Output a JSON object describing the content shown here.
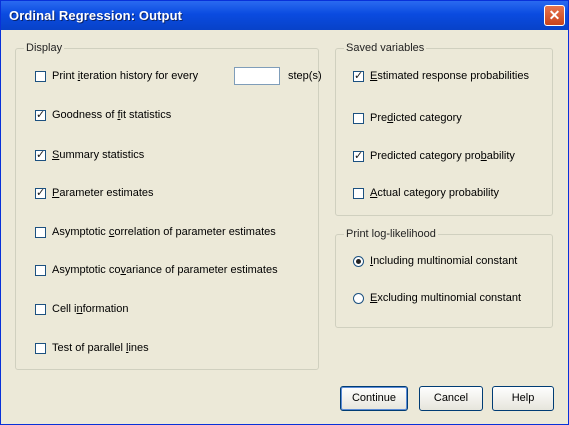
{
  "window": {
    "title": "Ordinal Regression: Output",
    "close_glyph": "✕"
  },
  "display": {
    "legend": "Display",
    "iteration": {
      "pre": "Print ",
      "u": "i",
      "post": "teration history for every",
      "step_value": "",
      "step_suffix": "step(s)",
      "checked": false
    },
    "items": [
      {
        "pre": "Goodness of ",
        "u": "f",
        "post": "it statistics",
        "checked": true
      },
      {
        "pre": "",
        "u": "S",
        "post": "ummary statistics",
        "checked": true
      },
      {
        "pre": "",
        "u": "P",
        "post": "arameter estimates",
        "checked": true
      },
      {
        "pre": "Asymptotic ",
        "u": "c",
        "post": "orrelation of parameter estimates",
        "checked": false
      },
      {
        "pre": "Asymptotic co",
        "u": "v",
        "post": "ariance of parameter estimates",
        "checked": false
      },
      {
        "pre": "Cell i",
        "u": "n",
        "post": "formation",
        "checked": false
      },
      {
        "pre": "Test of parallel ",
        "u": "l",
        "post": "ines",
        "checked": false
      }
    ]
  },
  "saved": {
    "legend": "Saved variables",
    "items": [
      {
        "pre": "",
        "u": "E",
        "post": "stimated response probabilities",
        "checked": true
      },
      {
        "pre": "Pre",
        "u": "d",
        "post": "icted category",
        "checked": false
      },
      {
        "pre": "Predicted category pro",
        "u": "b",
        "post": "ability",
        "checked": true
      },
      {
        "pre": "",
        "u": "A",
        "post": "ctual category probability",
        "checked": false
      }
    ]
  },
  "loglik": {
    "legend": "Print log-likelihood",
    "options": [
      {
        "pre": "",
        "u": "I",
        "post": "ncluding multinomial constant",
        "selected": true
      },
      {
        "pre": "",
        "u": "E",
        "post": "xcluding multinomial constant",
        "selected": false
      }
    ]
  },
  "buttons": {
    "continue": "Continue",
    "cancel": "Cancel",
    "help": "Help"
  }
}
